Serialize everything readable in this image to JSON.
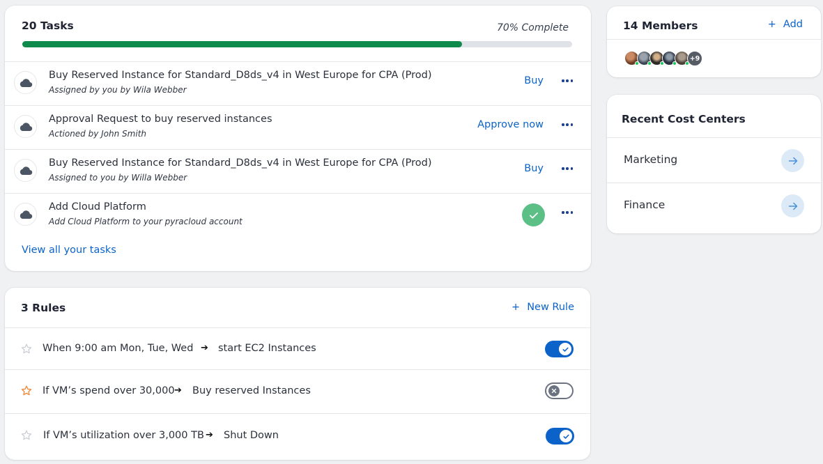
{
  "tasks": {
    "title": "20 Tasks",
    "complete_label": "70% Complete",
    "progress": 0.8,
    "colors": {
      "progress": "#0e8a4a",
      "track": "#dfe2e6",
      "link": "#0b63c9"
    },
    "items": [
      {
        "title": "Buy Reserved Instance for Standard_D8ds_v4 in West Europe for CPA (Prod)",
        "subtitle": "Assigned by you by Wila Webber",
        "action": "Buy",
        "icon": "cloud-icon"
      },
      {
        "title": "Approval Request to buy reserved instances",
        "subtitle": "Actioned by John Smith",
        "action": "Approve now",
        "icon": "cloud-icon"
      },
      {
        "title": "Buy Reserved Instance for Standard_D8ds_v4 in West Europe for CPA (Prod)",
        "subtitle": "Assigned to you by Willa Webber",
        "action": "Buy",
        "icon": "cloud-icon"
      },
      {
        "title": "Add Cloud Platform",
        "subtitle": "Add Cloud Platform to your pyracloud account",
        "action": "",
        "status": "completed",
        "status_icon": "check-icon",
        "icon": "cloud-icon"
      }
    ],
    "view_all": "View all your tasks"
  },
  "rules": {
    "title": "3 Rules",
    "new_rule": "New Rule",
    "items": [
      {
        "condition": "When 9:00 am Mon, Tue, Wed",
        "action": "start EC2 Instances",
        "starred": false,
        "enabled": true
      },
      {
        "condition": "If VM’s spend over 30,000",
        "action": "Buy reserved Instances",
        "starred": true,
        "enabled": false
      },
      {
        "condition": "If VM’s utilization over 3,000 TB",
        "action": "Shut Down",
        "starred": false,
        "enabled": true
      }
    ]
  },
  "members": {
    "title": "14 Members",
    "add_label": "Add",
    "overflow_label": "+9",
    "avatar_count": 5
  },
  "cost_centers": {
    "title": "Recent Cost Centers",
    "items": [
      {
        "label": "Marketing"
      },
      {
        "label": "Finance"
      }
    ]
  }
}
